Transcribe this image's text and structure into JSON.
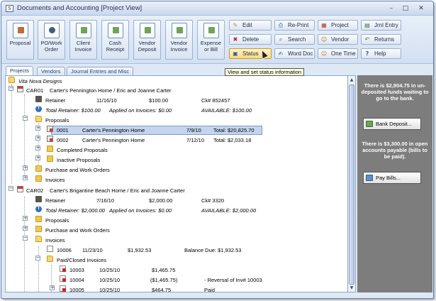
{
  "window": {
    "icon_glyph": "S",
    "title": "Documents and Accounting [Project View]",
    "min_glyph": "–",
    "max_glyph": "□",
    "close_glyph": "✕"
  },
  "toolbar": {
    "big_buttons": [
      {
        "label": "Proposal",
        "icon": "house-icon"
      },
      {
        "label": "PO/Work Order",
        "icon": "camera-icon"
      },
      {
        "label": "Client Invoice",
        "icon": "invoice-icon"
      },
      {
        "label": "Cash Receipt",
        "icon": "cash-icon"
      },
      {
        "label": "Vendor Deposit",
        "icon": "deposit-icon"
      },
      {
        "label": "Vendor Invoice",
        "icon": "vendor-invoice-icon"
      },
      {
        "label": "Expense or Bill",
        "icon": "calculator-icon"
      }
    ],
    "small_buttons": [
      {
        "label": "Edit",
        "glyph": "✎"
      },
      {
        "label": "Delete",
        "glyph": "✖"
      },
      {
        "label": "Status",
        "glyph": "▣"
      },
      {
        "label": "Re-Print",
        "glyph": "⎙"
      },
      {
        "label": "Search",
        "glyph": "⌕"
      },
      {
        "label": "Word Doc",
        "glyph": "✍"
      },
      {
        "label": "Project",
        "glyph": "▦"
      },
      {
        "label": "Vendor",
        "glyph": "☺"
      },
      {
        "label": "One Time",
        "glyph": "☺"
      },
      {
        "label": "Jrnl Entry",
        "glyph": "▤"
      },
      {
        "label": "Returns",
        "glyph": "↶"
      },
      {
        "label": "Help",
        "glyph": "?"
      }
    ],
    "active_button": "Status"
  },
  "tooltip": "View and set status information",
  "tabs": [
    {
      "label": "Projects",
      "active": true
    },
    {
      "label": "Vendors",
      "active": false
    },
    {
      "label": "Journal Entries and Misc",
      "active": false
    }
  ],
  "tree": {
    "root": "Vita Nova Designs",
    "car01": {
      "code": "CAR01",
      "name": "Carter's Pennington Home / Eric and Joanne Carter",
      "retainer_label": "Retainer",
      "retainer_date": "11/16/10",
      "retainer_amount": "$100.00",
      "retainer_check": "Ck# 852457",
      "total_retainer": "Total Retainer: $100.00",
      "applied": "Applied on Invoices: $0.00",
      "available": "AVAILABLE: $100.00",
      "proposals_label": "Proposals",
      "proposal_rows": [
        {
          "num": "0001",
          "name": "Carter's Pennington Home",
          "date": "7/9/10",
          "total": "Total: $20,825.70",
          "selected": true
        },
        {
          "num": "0002",
          "name": "Carter's Pennington Home",
          "date": "7/12/10",
          "total": "Total: $2,033.18",
          "selected": false
        }
      ],
      "completed_proposals": "Completed Proposals",
      "inactive_proposals": "Inactive Proposals",
      "purchase_orders": "Purchase and Work Orders",
      "invoices": "Invoices"
    },
    "car02": {
      "code": "CAR02",
      "name": "Carter's Brigantine Beach Home / Eric and Joanne Carter",
      "retainer_label": "Retainer",
      "retainer_date": "7/16/10",
      "retainer_amount": "$2,000.00",
      "retainer_check": "Ck# 3320",
      "total_retainer": "Total Retainer: $2,000.00",
      "applied": "Applied on Invoices: $0.00",
      "available": "AVAILABLE: $2,000.00",
      "proposals_label": "Proposals",
      "purchase_orders": "Purchase and Work Orders",
      "invoices": "Invoices",
      "invoice_row": {
        "num": "10006",
        "date": "11/23/10",
        "amount": "$1,932.53",
        "balance": "Balance Due:  $1,932.53"
      },
      "paid_closed": "Paid/Closed Invoices",
      "paid_rows": [
        {
          "num": "10003",
          "date": "10/25/10",
          "amount": "$1,465.75",
          "note": ""
        },
        {
          "num": "10004",
          "date": "10/25/10",
          "amount": "($1,465.75)",
          "note": "- Reversal of Inv# 10003"
        },
        {
          "num": "10005",
          "date": "10/25/10",
          "amount": "$464.75",
          "note": "Paid"
        }
      ]
    }
  },
  "side_panel": {
    "msg1": "There is $2,904.75 in un-deposited funds waiting to go to the bank.",
    "btn1": "Bank Deposit...",
    "msg2": "There is $3,300.00 in open accounts payable (bills to be paid).",
    "btn2": "Pay Bills..."
  }
}
